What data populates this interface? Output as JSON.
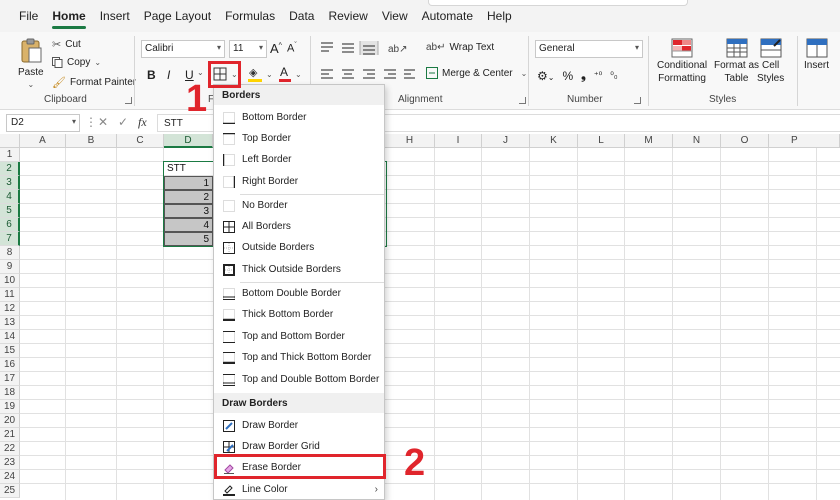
{
  "menu_tabs": [
    "File",
    "Home",
    "Insert",
    "Page Layout",
    "Formulas",
    "Data",
    "Review",
    "View",
    "Automate",
    "Help"
  ],
  "active_tab": "Home",
  "clipboard": {
    "paste": "Paste",
    "cut": "Cut",
    "copy": "Copy",
    "format_painter": "Format Painter",
    "label": "Clipboard"
  },
  "font": {
    "family": "Calibri",
    "size": "11",
    "bold": "B",
    "italic": "I",
    "underline": "U",
    "label": "F"
  },
  "alignment": {
    "wrap_text": "Wrap Text",
    "merge_center": "Merge & Center",
    "label": "Alignment"
  },
  "number": {
    "format": "General",
    "label": "Number",
    "percent": "%",
    "comma": "❟"
  },
  "styles": {
    "conditional": [
      "Conditional",
      "Formatting"
    ],
    "format_table": [
      "Format as",
      "Table"
    ],
    "cell_styles": [
      "Cell",
      "Styles"
    ],
    "label": "Styles"
  },
  "cells_group": {
    "insert": "Insert"
  },
  "formula_bar": {
    "name_box": "D2",
    "fx": "fx",
    "content": "STT"
  },
  "columns": [
    "A",
    "B",
    "C",
    "D",
    "E",
    "F",
    "G",
    "H",
    "I",
    "J",
    "K",
    "L",
    "M",
    "N",
    "O",
    "P"
  ],
  "rows": [
    "1",
    "2",
    "3",
    "4",
    "5",
    "6",
    "7",
    "8",
    "9",
    "10",
    "11",
    "12",
    "13",
    "14",
    "15",
    "16",
    "17",
    "18",
    "19",
    "20",
    "21",
    "22",
    "23",
    "24",
    "25"
  ],
  "cells": {
    "D2": "STT",
    "D3": "1",
    "D4": "2",
    "D5": "3",
    "D6": "4",
    "D7": "5"
  },
  "borders_menu": {
    "header": "Borders",
    "items": [
      "Bottom Border",
      "Top Border",
      "Left Border",
      "Right Border",
      "No Border",
      "All Borders",
      "Outside Borders",
      "Thick Outside Borders",
      "Bottom Double Border",
      "Thick Bottom Border",
      "Top and Bottom Border",
      "Top and Thick Bottom Border",
      "Top and Double Bottom Border"
    ],
    "draw_header": "Draw Borders",
    "draw_items": [
      "Draw Border",
      "Draw Border Grid",
      "Erase Border",
      "Line Color"
    ],
    "submenu_arrow": "›"
  },
  "annotations": {
    "step1": "1",
    "step2": "2"
  },
  "colors": {
    "accent": "#1b7a43",
    "annotation": "#e0252c",
    "font_color_bar": "#e0252c",
    "fill_color_bar": "#ffd400"
  }
}
